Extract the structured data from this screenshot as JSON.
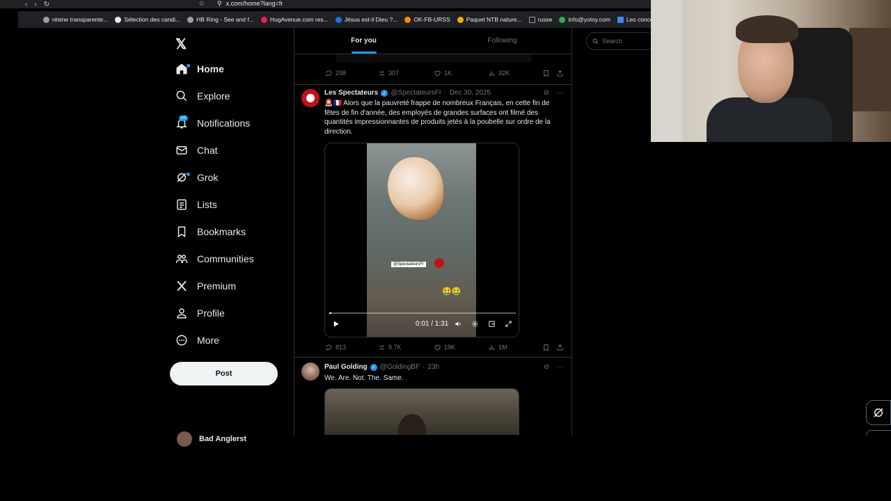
{
  "browser": {
    "url": "x.com/home?lang=fr",
    "bookmarks": [
      {
        "label": "résine transparente...",
        "color": "#9aa0a6"
      },
      {
        "label": "Sélection des candi...",
        "color": "#e8eaed"
      },
      {
        "label": "HB Ring - See and f...",
        "color": "#9aa0a6"
      },
      {
        "label": "HugAvenue.com res...",
        "color": "#e91e63"
      },
      {
        "label": "Jésus est-il Dieu ?...",
        "color": "#1a73e8"
      },
      {
        "label": "OK-FB-URSS",
        "color": "#ff8a00"
      },
      {
        "label": "Paquet NTB nature...",
        "color": "#f9ab00"
      },
      {
        "label": "russe",
        "color": "#9aa0a6"
      },
      {
        "label": "info@yotoy.com",
        "color": "#34a853"
      },
      {
        "label": "Les concou",
        "color": "#4285f4"
      }
    ]
  },
  "sidebar": {
    "items": [
      {
        "label": "Home",
        "icon": "home-icon"
      },
      {
        "label": "Explore",
        "icon": "search-icon"
      },
      {
        "label": "Notifications",
        "icon": "bell-icon",
        "badge": "10"
      },
      {
        "label": "Chat",
        "icon": "mail-icon"
      },
      {
        "label": "Grok",
        "icon": "grok-icon"
      },
      {
        "label": "Lists",
        "icon": "list-icon"
      },
      {
        "label": "Bookmarks",
        "icon": "bookmark-icon"
      },
      {
        "label": "Communities",
        "icon": "communities-icon"
      },
      {
        "label": "Premium",
        "icon": "x-icon"
      },
      {
        "label": "Profile",
        "icon": "person-icon"
      },
      {
        "label": "More",
        "icon": "more-circle-icon"
      }
    ],
    "post_label": "Post",
    "account_name": "Bad Anglerst"
  },
  "tabs": [
    {
      "label": "For you",
      "active": true
    },
    {
      "label": "Following",
      "active": false
    }
  ],
  "prev_tweet": {
    "stats": {
      "replies": "298",
      "reposts": "307",
      "likes": "1K",
      "views": "32K"
    }
  },
  "tweet1": {
    "name": "Les Spectateurs",
    "handle": "@SpectateursFr",
    "date": "Dec 30, 2025",
    "text_line1": "🚨🇫🇷 Alors que la pauvreté frappe de nombreux Français, en cette fin de",
    "text_line2": "fêtes de fin d'année, des employés de grandes surfaces ont filmé des",
    "text_line3": "quantités impressionnantes de produits jetés à la poubelle sur ordre de la",
    "text_line4": "direction.",
    "video": {
      "watermark": "@SpectateursFr",
      "time": "0:01 / 1:31",
      "emoji": "🤮🤮",
      "progress": 0.01
    },
    "stats": {
      "replies": "813",
      "reposts": "9.7K",
      "likes": "19K",
      "views": "1M"
    }
  },
  "tweet2": {
    "name": "Paul Golding",
    "handle": "@GoldingBF",
    "date": "23h",
    "text": "We. Are. Not. The. Same."
  },
  "search": {
    "placeholder": "Search"
  },
  "colors": {
    "accent": "#1d9bf0",
    "background": "#000000",
    "text": "#e7e9ea",
    "muted": "#71767b",
    "border": "#2f3336"
  }
}
